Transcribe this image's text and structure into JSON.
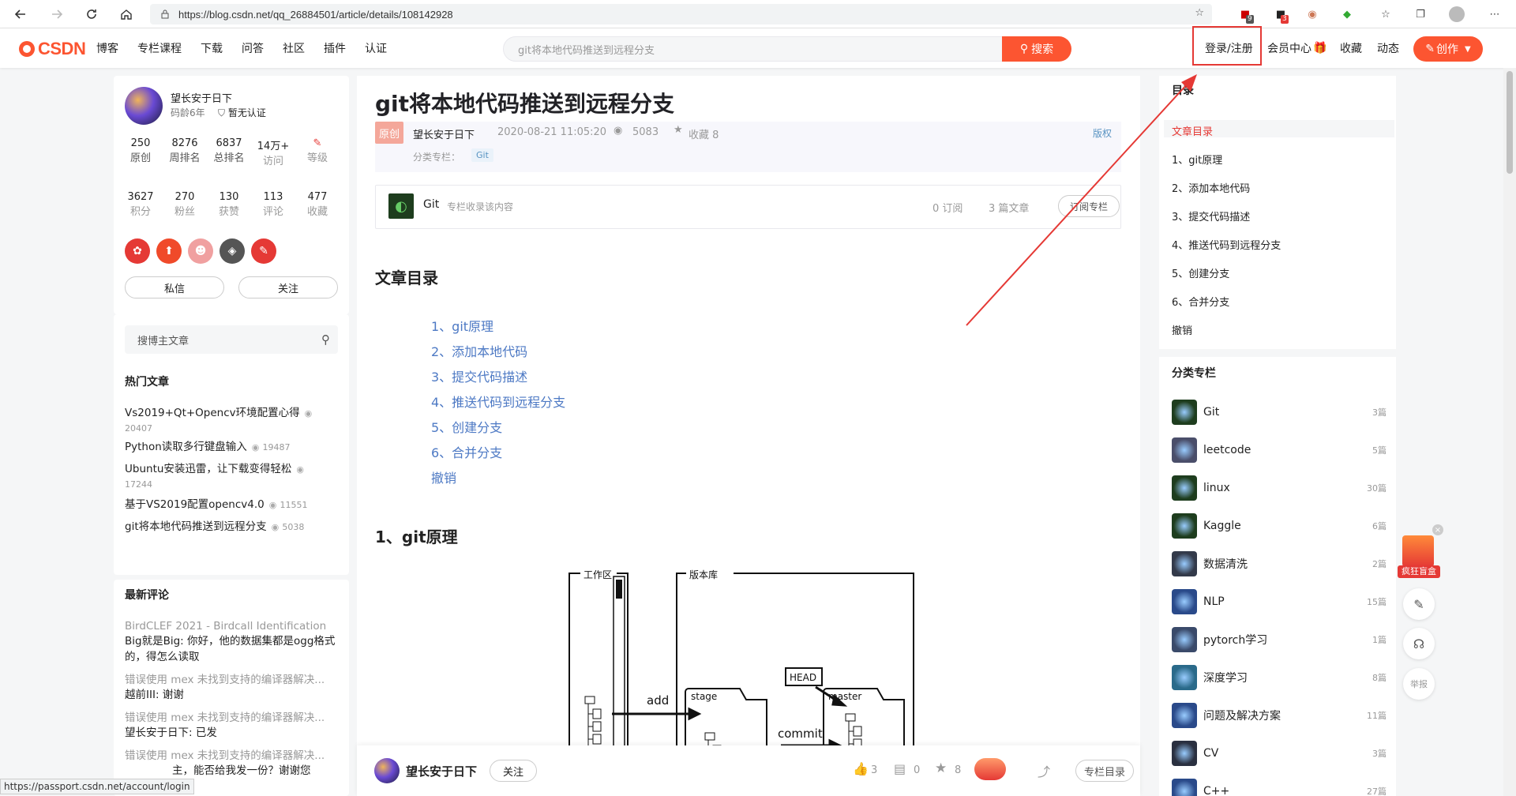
{
  "browser": {
    "url": "https://blog.csdn.net/qq_26884501/article/details/108142928",
    "ext_badges": [
      "9",
      "3"
    ]
  },
  "toolbar": {
    "nav": [
      "博客",
      "专栏课程",
      "下载",
      "问答",
      "社区",
      "插件",
      "认证"
    ],
    "search_placeholder": "git将本地代码推送到远程分支",
    "search_btn": "搜索",
    "login": "登录/注册",
    "vip": "会员中心",
    "favorites": "收藏",
    "dynamic": "动态",
    "create": "创作"
  },
  "profile": {
    "name": "望长安于日下",
    "age": "码龄6年",
    "cert": "暂无认证",
    "stats_row1": [
      {
        "num": "250",
        "label": "原创"
      },
      {
        "num": "8276",
        "label": "周排名"
      },
      {
        "num": "6837",
        "label": "总排名"
      },
      {
        "num": "14万+",
        "label": "访问"
      },
      {
        "num": "",
        "label": "等级"
      }
    ],
    "stats_row2": [
      {
        "num": "3627",
        "label": "积分"
      },
      {
        "num": "270",
        "label": "粉丝"
      },
      {
        "num": "130",
        "label": "获赞"
      },
      {
        "num": "113",
        "label": "评论"
      },
      {
        "num": "477",
        "label": "收藏"
      }
    ],
    "message_btn": "私信",
    "follow_btn": "关注"
  },
  "side_search": {
    "placeholder": "搜博主文章"
  },
  "hot": {
    "title": "热门文章",
    "items": [
      {
        "title": "Vs2019+Qt+Opencv环境配置心得",
        "views": "20407"
      },
      {
        "title": "Python读取多行键盘输入",
        "views": "19487"
      },
      {
        "title": "Ubuntu安装迅雷，让下载变得轻松",
        "views": "17244"
      },
      {
        "title": "基于VS2019配置opencv4.0",
        "views": "11551"
      },
      {
        "title": "git将本地代码推送到远程分支",
        "views": "5038"
      }
    ]
  },
  "comments": {
    "title": "最新评论",
    "items": [
      {
        "title": "BirdCLEF 2021 - Birdcall Identification",
        "body": "Big就是Big: 你好，他的数据集都是ogg格式的，得怎么读取"
      },
      {
        "title": "错误使用 mex 未找到支持的编译器解决...",
        "body": "越前III: 谢谢"
      },
      {
        "title": "错误使用 mex 未找到支持的编译器解决...",
        "body": "望长安于日下: 已发"
      },
      {
        "title": "错误使用 mex 未找到支持的编译器解决...",
        "body": "主，能否给我发一份？谢谢您"
      }
    ]
  },
  "article": {
    "title": "git将本地代码推送到远程分支",
    "original": "原创",
    "author": "望长安于日下",
    "date": "2020-08-21 11:05:20",
    "views": "5083",
    "favorites": "收藏 8",
    "copyright": "版权",
    "column_label": "分类专栏：",
    "column_tag": "Git",
    "column_box": {
      "name": "Git",
      "desc": "专栏收录该内容",
      "subs": "0 订阅",
      "count": "3 篇文章",
      "btn": "订阅专栏"
    },
    "toc_title": "文章目录",
    "toc": [
      "1、git原理",
      "2、添加本地代码",
      "3、提交代码描述",
      "4、推送代码到远程分支",
      "5、创建分支",
      "6、合并分支",
      "撤销"
    ],
    "section1": "1、git原理",
    "diagram": {
      "workspace": "工作区",
      "repo": "版本库",
      "add": "add",
      "stage": "stage",
      "head": "HEAD",
      "master": "master",
      "commit": "commit"
    }
  },
  "bottom": {
    "author": "望长安于日下",
    "follow": "关注",
    "likes": "3",
    "comments": "0",
    "stars": "8",
    "toc_btn": "专栏目录"
  },
  "right_toc": {
    "title": "目录",
    "items": [
      "文章目录",
      "1、git原理",
      "2、添加本地代码",
      "3、提交代码描述",
      "4、推送代码到远程分支",
      "5、创建分支",
      "6、合并分支",
      "撤销"
    ]
  },
  "columns": {
    "title": "分类专栏",
    "items": [
      {
        "name": "Git",
        "count": "3篇",
        "color": "#1e3d1e"
      },
      {
        "name": "leetcode",
        "count": "5篇",
        "color": "#4a4e6a"
      },
      {
        "name": "linux",
        "count": "30篇",
        "color": "#1e3d1e"
      },
      {
        "name": "Kaggle",
        "count": "6篇",
        "color": "#1e3d1e"
      },
      {
        "name": "数据清洗",
        "count": "2篇",
        "color": "#333a4a"
      },
      {
        "name": "NLP",
        "count": "15篇",
        "color": "#2a4a8a"
      },
      {
        "name": "pytorch学习",
        "count": "1篇",
        "color": "#3a4a6a"
      },
      {
        "name": "深度学习",
        "count": "8篇",
        "color": "#2a6a8a"
      },
      {
        "name": "问题及解决方案",
        "count": "11篇",
        "color": "#2a4a8a"
      },
      {
        "name": "CV",
        "count": "3篇",
        "color": "#2a3040"
      },
      {
        "name": "C++",
        "count": "27篇",
        "color": "#2a4a8a"
      }
    ]
  },
  "floating": {
    "blindbox": "疯狂盲盒",
    "report": "举报"
  },
  "status_url": "https://passport.csdn.net/account/login"
}
